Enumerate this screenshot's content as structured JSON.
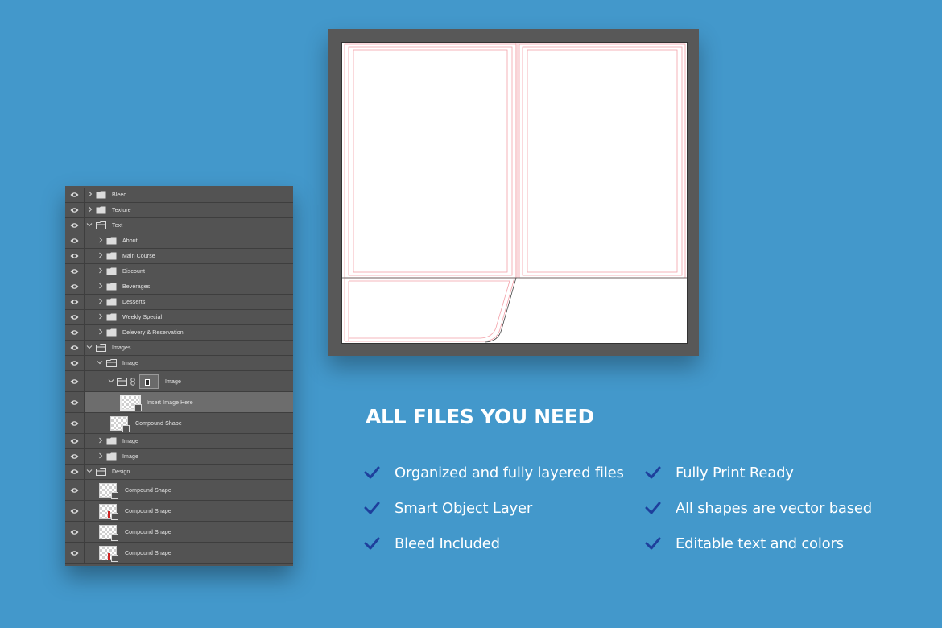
{
  "layers_panel": {
    "rows": [
      {
        "name": "Bleed"
      },
      {
        "name": "Texture"
      },
      {
        "name": "Text"
      },
      {
        "name": "About"
      },
      {
        "name": "Main Course"
      },
      {
        "name": "Discount"
      },
      {
        "name": "Beverages"
      },
      {
        "name": "Desserts"
      },
      {
        "name": "Weekly Special"
      },
      {
        "name": "Delevery & Reservation"
      },
      {
        "name": "Images"
      },
      {
        "name": "Image"
      },
      {
        "name": "Image"
      },
      {
        "name": "Insert Image Here"
      },
      {
        "name": "Compound Shape"
      },
      {
        "name": "Image"
      },
      {
        "name": "Image"
      },
      {
        "name": "Design"
      },
      {
        "name": "Compound Shape"
      },
      {
        "name": "Compound Shape"
      },
      {
        "name": "Compound Shape"
      },
      {
        "name": "Compound Shape"
      }
    ]
  },
  "features": {
    "title": "ALL FILES YOU NEED",
    "check_color": "#1e3f9c",
    "items": [
      "Organized and fully layered files",
      "Fully Print Ready",
      "Smart Object Layer",
      "All shapes are vector based",
      "Bleed Included",
      "Editable text and colors"
    ]
  },
  "colors": {
    "background": "#4398cb",
    "panel": "#535353",
    "guides": "#f3a0a8"
  }
}
